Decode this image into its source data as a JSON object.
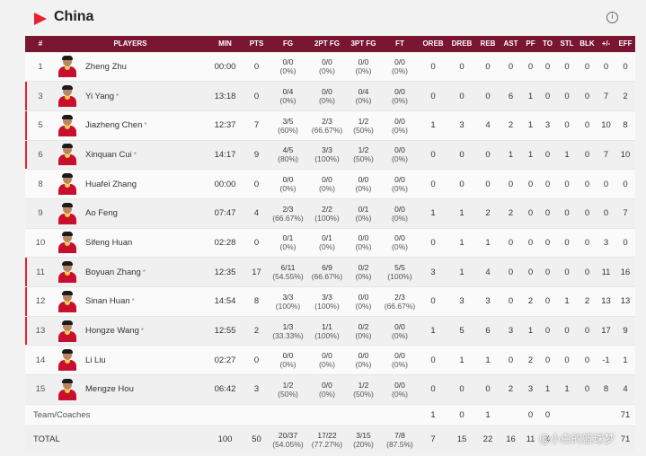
{
  "team": {
    "name": "China",
    "accent_color": "#e8212f",
    "header_color": "#7b1632"
  },
  "columns": [
    "#",
    "PLAYERS",
    "MIN",
    "PTS",
    "FG",
    "2PT FG",
    "3PT FG",
    "FT",
    "OREB",
    "DREB",
    "REB",
    "AST",
    "PF",
    "TO",
    "STL",
    "BLK",
    "+/-",
    "EFF"
  ],
  "players": [
    {
      "num": "1",
      "name": "Zheng Zhu",
      "starter": false,
      "min": "00:00",
      "pts": "0",
      "fg": [
        "0/0",
        "(0%)"
      ],
      "fg2": [
        "0/0",
        "(0%)"
      ],
      "fg3": [
        "0/0",
        "(0%)"
      ],
      "ft": [
        "0/0",
        "(0%)"
      ],
      "oreb": "0",
      "dreb": "0",
      "reb": "0",
      "ast": "0",
      "pf": "0",
      "to": "0",
      "stl": "0",
      "blk": "0",
      "pm": "0",
      "eff": "0"
    },
    {
      "num": "3",
      "name": "Yi Yang",
      "starter": true,
      "min": "13:18",
      "pts": "0",
      "fg": [
        "0/4",
        "(0%)"
      ],
      "fg2": [
        "0/0",
        "(0%)"
      ],
      "fg3": [
        "0/4",
        "(0%)"
      ],
      "ft": [
        "0/0",
        "(0%)"
      ],
      "oreb": "0",
      "dreb": "0",
      "reb": "0",
      "ast": "6",
      "pf": "1",
      "to": "0",
      "stl": "0",
      "blk": "0",
      "pm": "7",
      "eff": "2"
    },
    {
      "num": "5",
      "name": "Jiazheng Chen",
      "starter": true,
      "min": "12:37",
      "pts": "7",
      "fg": [
        "3/5",
        "(60%)"
      ],
      "fg2": [
        "2/3",
        "(66.67%)"
      ],
      "fg3": [
        "1/2",
        "(50%)"
      ],
      "ft": [
        "0/0",
        "(0%)"
      ],
      "oreb": "1",
      "dreb": "3",
      "reb": "4",
      "ast": "2",
      "pf": "1",
      "to": "3",
      "stl": "0",
      "blk": "0",
      "pm": "10",
      "eff": "8"
    },
    {
      "num": "6",
      "name": "Xinquan Cui",
      "starter": true,
      "min": "14:17",
      "pts": "9",
      "fg": [
        "4/5",
        "(80%)"
      ],
      "fg2": [
        "3/3",
        "(100%)"
      ],
      "fg3": [
        "1/2",
        "(50%)"
      ],
      "ft": [
        "0/0",
        "(0%)"
      ],
      "oreb": "0",
      "dreb": "0",
      "reb": "0",
      "ast": "1",
      "pf": "1",
      "to": "0",
      "stl": "1",
      "blk": "0",
      "pm": "7",
      "eff": "10"
    },
    {
      "num": "8",
      "name": "Huafei Zhang",
      "starter": false,
      "min": "00:00",
      "pts": "0",
      "fg": [
        "0/0",
        "(0%)"
      ],
      "fg2": [
        "0/0",
        "(0%)"
      ],
      "fg3": [
        "0/0",
        "(0%)"
      ],
      "ft": [
        "0/0",
        "(0%)"
      ],
      "oreb": "0",
      "dreb": "0",
      "reb": "0",
      "ast": "0",
      "pf": "0",
      "to": "0",
      "stl": "0",
      "blk": "0",
      "pm": "0",
      "eff": "0"
    },
    {
      "num": "9",
      "name": "Ao Feng",
      "starter": false,
      "min": "07:47",
      "pts": "4",
      "fg": [
        "2/3",
        "(66.67%)"
      ],
      "fg2": [
        "2/2",
        "(100%)"
      ],
      "fg3": [
        "0/1",
        "(0%)"
      ],
      "ft": [
        "0/0",
        "(0%)"
      ],
      "oreb": "1",
      "dreb": "1",
      "reb": "2",
      "ast": "2",
      "pf": "0",
      "to": "0",
      "stl": "0",
      "blk": "0",
      "pm": "0",
      "eff": "7"
    },
    {
      "num": "10",
      "name": "Sifeng Huan",
      "starter": false,
      "min": "02:28",
      "pts": "0",
      "fg": [
        "0/1",
        "(0%)"
      ],
      "fg2": [
        "0/1",
        "(0%)"
      ],
      "fg3": [
        "0/0",
        "(0%)"
      ],
      "ft": [
        "0/0",
        "(0%)"
      ],
      "oreb": "0",
      "dreb": "1",
      "reb": "1",
      "ast": "0",
      "pf": "0",
      "to": "0",
      "stl": "0",
      "blk": "0",
      "pm": "3",
      "eff": "0"
    },
    {
      "num": "11",
      "name": "Boyuan Zhang",
      "starter": true,
      "min": "12:35",
      "pts": "17",
      "fg": [
        "6/11",
        "(54.55%)"
      ],
      "fg2": [
        "6/9",
        "(66.67%)"
      ],
      "fg3": [
        "0/2",
        "(0%)"
      ],
      "ft": [
        "5/5",
        "(100%)"
      ],
      "oreb": "3",
      "dreb": "1",
      "reb": "4",
      "ast": "0",
      "pf": "0",
      "to": "0",
      "stl": "0",
      "blk": "0",
      "pm": "11",
      "eff": "16"
    },
    {
      "num": "12",
      "name": "Sinan Huan",
      "starter": true,
      "min": "14:54",
      "pts": "8",
      "fg": [
        "3/3",
        "(100%)"
      ],
      "fg2": [
        "3/3",
        "(100%)"
      ],
      "fg3": [
        "0/0",
        "(0%)"
      ],
      "ft": [
        "2/3",
        "(66.67%)"
      ],
      "oreb": "0",
      "dreb": "3",
      "reb": "3",
      "ast": "0",
      "pf": "2",
      "to": "0",
      "stl": "1",
      "blk": "2",
      "pm": "13",
      "eff": "13"
    },
    {
      "num": "13",
      "name": "Hongze Wang",
      "starter": true,
      "min": "12:55",
      "pts": "2",
      "fg": [
        "1/3",
        "(33.33%)"
      ],
      "fg2": [
        "1/1",
        "(100%)"
      ],
      "fg3": [
        "0/2",
        "(0%)"
      ],
      "ft": [
        "0/0",
        "(0%)"
      ],
      "oreb": "1",
      "dreb": "5",
      "reb": "6",
      "ast": "3",
      "pf": "1",
      "to": "0",
      "stl": "0",
      "blk": "0",
      "pm": "17",
      "eff": "9"
    },
    {
      "num": "14",
      "name": "Li Liu",
      "starter": false,
      "min": "02:27",
      "pts": "0",
      "fg": [
        "0/0",
        "(0%)"
      ],
      "fg2": [
        "0/0",
        "(0%)"
      ],
      "fg3": [
        "0/0",
        "(0%)"
      ],
      "ft": [
        "0/0",
        "(0%)"
      ],
      "oreb": "0",
      "dreb": "1",
      "reb": "1",
      "ast": "0",
      "pf": "2",
      "to": "0",
      "stl": "0",
      "blk": "0",
      "pm": "-1",
      "eff": "1"
    },
    {
      "num": "15",
      "name": "Mengze Hou",
      "starter": false,
      "min": "06:42",
      "pts": "3",
      "fg": [
        "1/2",
        "(50%)"
      ],
      "fg2": [
        "0/0",
        "(0%)"
      ],
      "fg3": [
        "1/2",
        "(50%)"
      ],
      "ft": [
        "0/0",
        "(0%)"
      ],
      "oreb": "0",
      "dreb": "0",
      "reb": "0",
      "ast": "2",
      "pf": "3",
      "to": "1",
      "stl": "1",
      "blk": "0",
      "pm": "8",
      "eff": "4"
    }
  ],
  "coaches": {
    "label": "Team/Coaches",
    "oreb": "1",
    "dreb": "0",
    "reb": "1",
    "ast": "",
    "pf": "0",
    "to": "0",
    "stl": "",
    "blk": "",
    "pm": "",
    "eff": "71"
  },
  "totals": {
    "label": "TOTAL",
    "min": "100",
    "pts": "50",
    "fg": [
      "20/37",
      "(54.05%)"
    ],
    "fg2": [
      "17/22",
      "(77.27%)"
    ],
    "fg3": [
      "3/15",
      "(20%)"
    ],
    "ft": [
      "7/8",
      "(87.5%)"
    ],
    "oreb": "7",
    "dreb": "15",
    "reb": "22",
    "ast": "16",
    "pf": "11",
    "to": "4",
    "stl": "",
    "blk": "",
    "pm": "",
    "eff": "71"
  },
  "watermark": "@小白的篮球梦"
}
